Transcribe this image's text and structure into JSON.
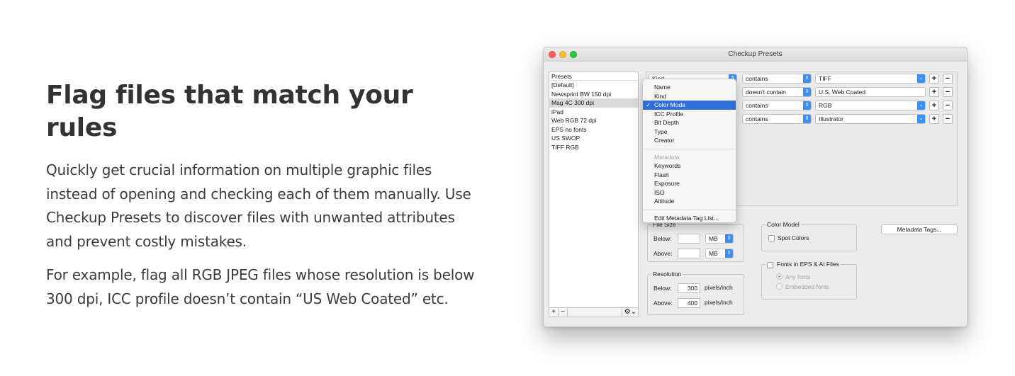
{
  "marketing": {
    "heading": "Flag files that match your rules",
    "paragraph1": "Quickly get crucial information on multiple graphic files instead of opening and checking each of them manually. Use Checkup Presets to discover files with unwanted attributes and prevent costly mistakes.",
    "paragraph2": "For example, flag all RGB JPEG files whose resolution is below 300 dpi, ICC profile doesn’t contain “US Web Coated” etc."
  },
  "window": {
    "title": "Checkup Presets"
  },
  "presets": {
    "header": "Presets",
    "items": [
      "[Default]",
      "Newsprint BW 150 dpi",
      "Mag 4C 300 dpi",
      "iPad",
      "Web RGB 72 dpi",
      "EPS no fonts",
      "US SWOP",
      "TIFF RGB"
    ],
    "selected": "Mag 4C 300 dpi",
    "add_label": "+",
    "remove_label": "−",
    "gear_label": "⚙︎⌄"
  },
  "criteria": {
    "rows": [
      {
        "field": "Kind",
        "operator": "contains",
        "value": "TIFF"
      },
      {
        "field": "",
        "operator": "doesn't contain",
        "value": "U.S. Web Coated"
      },
      {
        "field": "",
        "operator": "contains",
        "value": "RGB"
      },
      {
        "field": "",
        "operator": "contains",
        "value": "Illustrator"
      }
    ],
    "plus_label": "+",
    "minus_label": "−"
  },
  "field_menu": {
    "items": [
      "Name",
      "Kind",
      "Color Mode",
      "ICC Profile",
      "Bit Depth",
      "Type",
      "Creator"
    ],
    "selected": "Color Mode",
    "section_header": "Metadata",
    "metadata_items": [
      "Keywords",
      "Flash",
      "Exposure",
      "ISO",
      "Altitude"
    ],
    "edit_item": "Edit Metadata Tag List...",
    "check_mark": "✓"
  },
  "file_size": {
    "title": "File Size",
    "below_label": "Below:",
    "above_label": "Above:",
    "below_value": "",
    "above_value": "",
    "below_unit": "MB",
    "above_unit": "MB"
  },
  "resolution": {
    "title": "Resolution",
    "below_label": "Below:",
    "above_label": "Above:",
    "below_value": "300",
    "above_value": "400",
    "unit": "pixels/inch"
  },
  "color_model": {
    "title": "Color Model",
    "spot_colors_label": "Spot Colors"
  },
  "fonts": {
    "title": "Fonts in EPS & AI Files",
    "any_fonts_label": "Any fonts",
    "embedded_fonts_label": "Embedded fonts"
  },
  "metadata_tags_button": "Metadata Tags...",
  "colors": {
    "accent": "#3d8ef5",
    "menu_selection": "#2f6ed9",
    "close": "#fd5f57",
    "minimize": "#febc2e",
    "zoom": "#28c840"
  }
}
